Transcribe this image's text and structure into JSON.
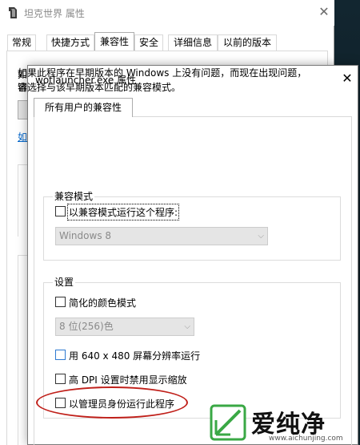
{
  "back_window": {
    "title": "坦克世界 属性",
    "tabs": [
      "常规",
      "快捷方式",
      "兼容性",
      "安全",
      "详细信息",
      "以前的版本"
    ],
    "fragments": {
      "line1": "如",
      "line2": "容",
      "link": "如"
    }
  },
  "dialog": {
    "title": "wotlauncher.exe 属性",
    "tab": "所有用户的兼容性",
    "description": "如果此程序在早期版本的 Windows 上没有问题，而现在出现问题，请选择与该早期版本匹配的兼容模式。",
    "compat": {
      "group_label": "兼容模式",
      "checkbox_label": "以兼容模式运行这个程序:",
      "os_select": "Windows 8"
    },
    "settings": {
      "group_label": "设置",
      "reduced_color": "简化的颜色模式",
      "color_select": "8 位(256)色",
      "resolution": "用 640 x 480 屏幕分辨率运行",
      "dpi": "高 DPI 设置时禁用显示缩放",
      "admin": "以管理员身份运行此程序"
    }
  },
  "watermark": {
    "brand": "爱纯净",
    "url": "www.aichunjing.com"
  },
  "colors": {
    "highlight": "#c0201a",
    "link": "#0066cc",
    "focus_checkbox": "#2f7ad1",
    "watermark_green": "#3aa845"
  },
  "icons": {
    "app": "tank-world-app-icon",
    "close": "close-icon",
    "dropdown": "chevron-down-icon",
    "watermark": "aichunjing-logo-icon"
  }
}
